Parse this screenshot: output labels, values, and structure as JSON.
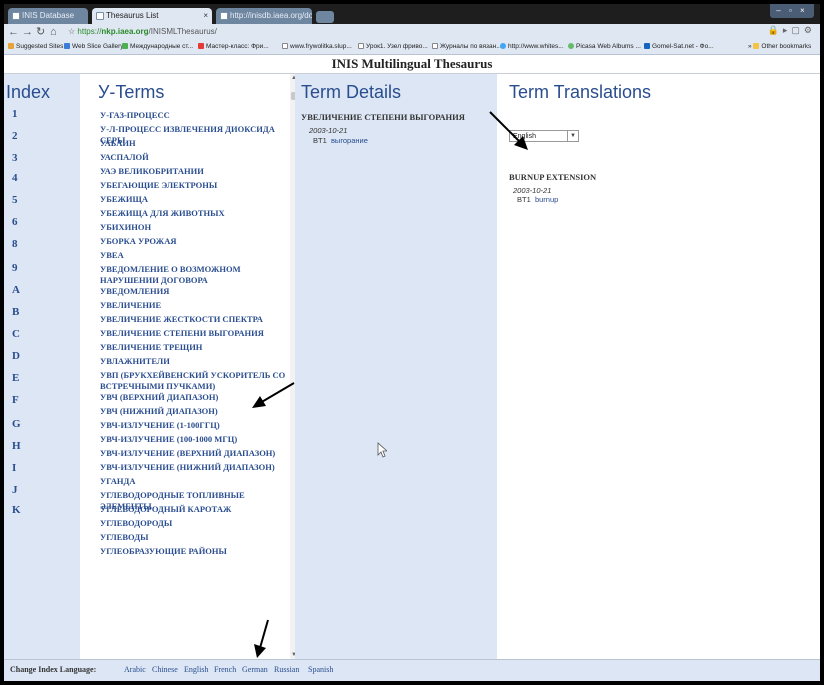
{
  "browser": {
    "tabs": [
      {
        "label": "INIS Database"
      },
      {
        "label": "Thesaurus List"
      },
      {
        "label": "http://inisdb.iaea.org/do..."
      }
    ],
    "url_scheme": "https://",
    "url_host": "nkp.iaea.org",
    "url_path": "/INISMLThesaurus/",
    "bookmarks": [
      "Suggested Sites",
      "Web Slice Gallery",
      "Международные ст...",
      "Мастер-класс: Фри...",
      "www.frywolitka.slup...",
      "Урок1. Узел фриво...",
      "Журналы по вязан...",
      "http://www.whites...",
      "Picasa Web Albums ...",
      "Gomel-Sat.net - Фо..."
    ],
    "other_bookmarks": "Other bookmarks"
  },
  "site": {
    "title": "INIS Multilingual Thesaurus"
  },
  "index": {
    "heading": "Index",
    "items": [
      "1",
      "2",
      "3",
      "4",
      "5",
      "6",
      "8",
      "9",
      "A",
      "B",
      "C",
      "D",
      "E",
      "F",
      "G",
      "H",
      "I",
      "J",
      "K"
    ]
  },
  "yterms": {
    "heading": "У-Terms",
    "items": [
      "У-ГАЗ-ПРОЦЕСС",
      "У-Л-ПРОЦЕСС ИЗВЛЕЧЕНИЯ ДИОКСИДА СЕРЫ",
      "УАБАИН",
      "УАСПАЛОЙ",
      "УАЭ ВЕЛИКОБРИТАНИИ",
      "УБЕГАЮЩИЕ ЭЛЕКТРОНЫ",
      "УБЕЖИЩА",
      "УБЕЖИЩА ДЛЯ ЖИВОТНЫХ",
      "УБИХИНОН",
      "УБОРКА УРОЖАЯ",
      "УВЕА",
      "УВЕДОМЛЕНИЕ О ВОЗМОЖНОМ НАРУШЕНИИ ДОГОВОРА",
      "УВЕДОМЛЕНИЯ",
      "УВЕЛИЧЕНИЕ",
      "УВЕЛИЧЕНИЕ ЖЕСТКОСТИ СПЕКТРА",
      "УВЕЛИЧЕНИЕ СТЕПЕНИ ВЫГОРАНИЯ",
      "УВЕЛИЧЕНИЕ ТРЕЩИН",
      "УВЛАЖНИТЕЛИ",
      "УВП (БРУКХЕЙВЕНСКИЙ УСКОРИТЕЛЬ СО ВСТРЕЧНЫМИ ПУЧКАМИ)",
      "УВЧ (ВЕРХНИЙ ДИАПАЗОН)",
      "УВЧ (НИЖНИЙ ДИАПАЗОН)",
      "УВЧ-ИЗЛУЧЕНИЕ (1-100ГГЦ)",
      "УВЧ-ИЗЛУЧЕНИЕ (100-1000 МГЦ)",
      "УВЧ-ИЗЛУЧЕНИЕ (ВЕРХНИЙ ДИАПАЗОН)",
      "УВЧ-ИЗЛУЧЕНИЕ (НИЖНИЙ ДИАПАЗОН)",
      "УГАНДА",
      "УГЛЕВОДОРОДНЫЕ ТОПЛИВНЫЕ ЭЛЕМЕНТЫ",
      "УГЛЕВОДОРОДНЫЙ КАРОТАЖ",
      "УГЛЕВОДОРОДЫ",
      "УГЛЕВОДЫ",
      "УГЛЕОБРАЗУЮЩИЕ РАЙОНЫ"
    ]
  },
  "details": {
    "heading": "Term Details",
    "term": "УВЕЛИЧЕНИЕ СТЕПЕНИ ВЫГОРАНИЯ",
    "date": "2003-10-21",
    "rel_code": "BT1",
    "rel_term": "выгорание"
  },
  "translations": {
    "heading": "Term Translations",
    "selected_language": "English",
    "term": "BURNUP EXTENSION",
    "date": "2003-10-21",
    "rel_code": "BT1",
    "rel_term": "burnup"
  },
  "footer": {
    "label": "Change Index Language:",
    "languages": [
      "Arabic",
      "Chinese",
      "English",
      "French",
      "German",
      "Russian",
      "Spanish"
    ]
  },
  "colors": {
    "link": "#2a4d8f",
    "panel_bg": "#dce6f4",
    "frame": "#000000"
  }
}
